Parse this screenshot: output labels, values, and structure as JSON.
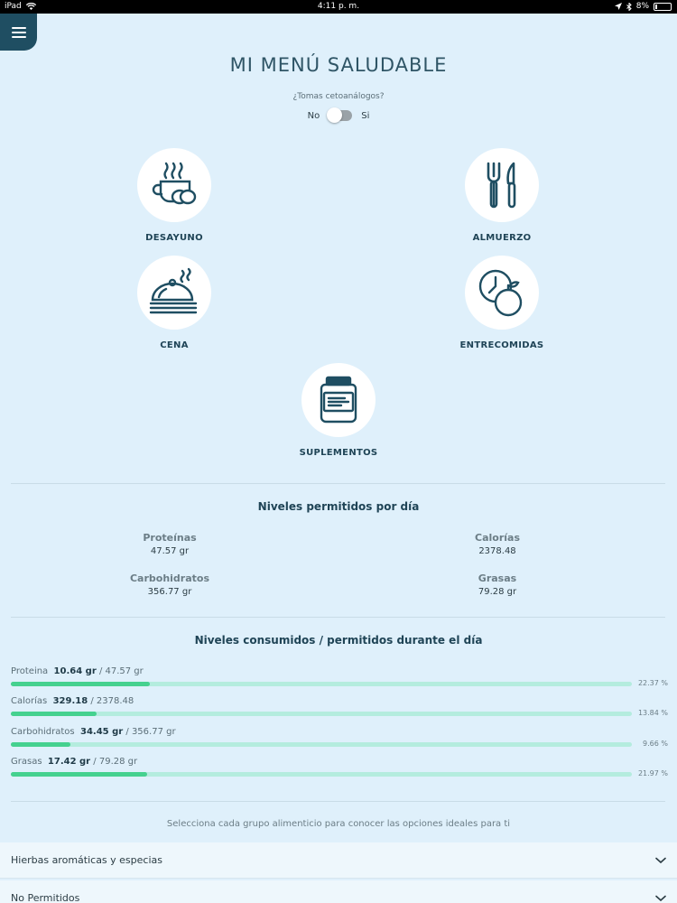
{
  "status_bar": {
    "device": "iPad",
    "time": "4:11 p. m.",
    "battery": "8%"
  },
  "header": {
    "title": "MI MENÚ SALUDABLE"
  },
  "toggle": {
    "question": "¿Tomas cetoanálogos?",
    "no_label": "No",
    "yes_label": "Si",
    "value": "No"
  },
  "meals": [
    {
      "label": "DESAYUNO",
      "icon": "coffee-cup-icon"
    },
    {
      "label": "ALMUERZO",
      "icon": "fork-knife-icon"
    },
    {
      "label": "CENA",
      "icon": "cloche-icon"
    },
    {
      "label": "ENTRECOMIDAS",
      "icon": "clock-apple-icon"
    },
    {
      "label": "SUPLEMENTOS",
      "icon": "supplement-jar-icon"
    }
  ],
  "allowed": {
    "title": "Niveles permitidos por día",
    "items": [
      {
        "name": "Proteínas",
        "value": "47.57 gr"
      },
      {
        "name": "Calorías",
        "value": "2378.48"
      },
      {
        "name": "Carbohidratos",
        "value": "356.77 gr"
      },
      {
        "name": "Grasas",
        "value": "79.28 gr"
      }
    ]
  },
  "consumed": {
    "title": "Niveles consumidos / permitidos durante el día",
    "items": [
      {
        "name": "Proteina",
        "consumed": "10.64 gr",
        "allowed": "/ 47.57 gr",
        "percent_label": "22.37 %",
        "fraction": 0.2237
      },
      {
        "name": "Calorías",
        "consumed": "329.18",
        "allowed": "/ 2378.48",
        "percent_label": "13.84 %",
        "fraction": 0.1384
      },
      {
        "name": "Carbohidratos",
        "consumed": "34.45 gr",
        "allowed": "/ 356.77 gr",
        "percent_label": "9.66 %",
        "fraction": 0.0966
      },
      {
        "name": "Grasas",
        "consumed": "17.42 gr",
        "allowed": "/ 79.28 gr",
        "percent_label": "21.97 %",
        "fraction": 0.2197
      }
    ]
  },
  "hint": "Selecciona cada grupo alimenticio para conocer las opciones ideales para ti",
  "groups": [
    {
      "label": "Hierbas aromáticas y especias"
    },
    {
      "label": "No Permitidos"
    }
  ],
  "colors": {
    "background": "#dff0fb",
    "accent": "#1f4e62",
    "progress_fill": "#45d18f",
    "progress_track": "#b4ecde"
  }
}
